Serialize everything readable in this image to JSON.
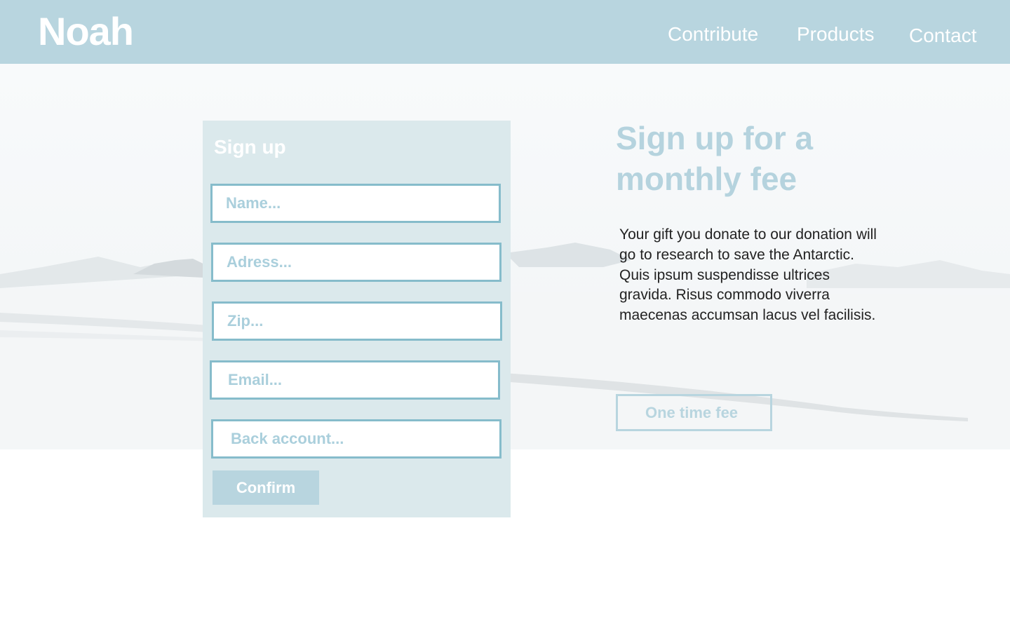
{
  "brand": {
    "logo": "Noah"
  },
  "nav": {
    "contribute": "Contribute",
    "products": "Products",
    "contact": "Contact"
  },
  "signup_form": {
    "title": "Sign up",
    "fields": {
      "name_placeholder": "Name...",
      "adress_placeholder": "Adress...",
      "zip_placeholder": "Zip...",
      "email_placeholder": "Email...",
      "bank_placeholder": "Back account..."
    },
    "confirm_label": "Confirm"
  },
  "promo": {
    "headline": "Sign up for a monthly fee",
    "body": "Your gift you donate to our donation will go to research to save the Antarctic. Quis ipsum suspendisse ultrices gravida. Risus commodo viverra maecenas accumsan lacus vel facilisis.",
    "one_time_label": "One time fee"
  },
  "colors": {
    "header_bg": "#b8d5df",
    "card_bg": "#dbe9ec",
    "field_border": "#86bccb",
    "accent_text": "#b5d3de"
  }
}
